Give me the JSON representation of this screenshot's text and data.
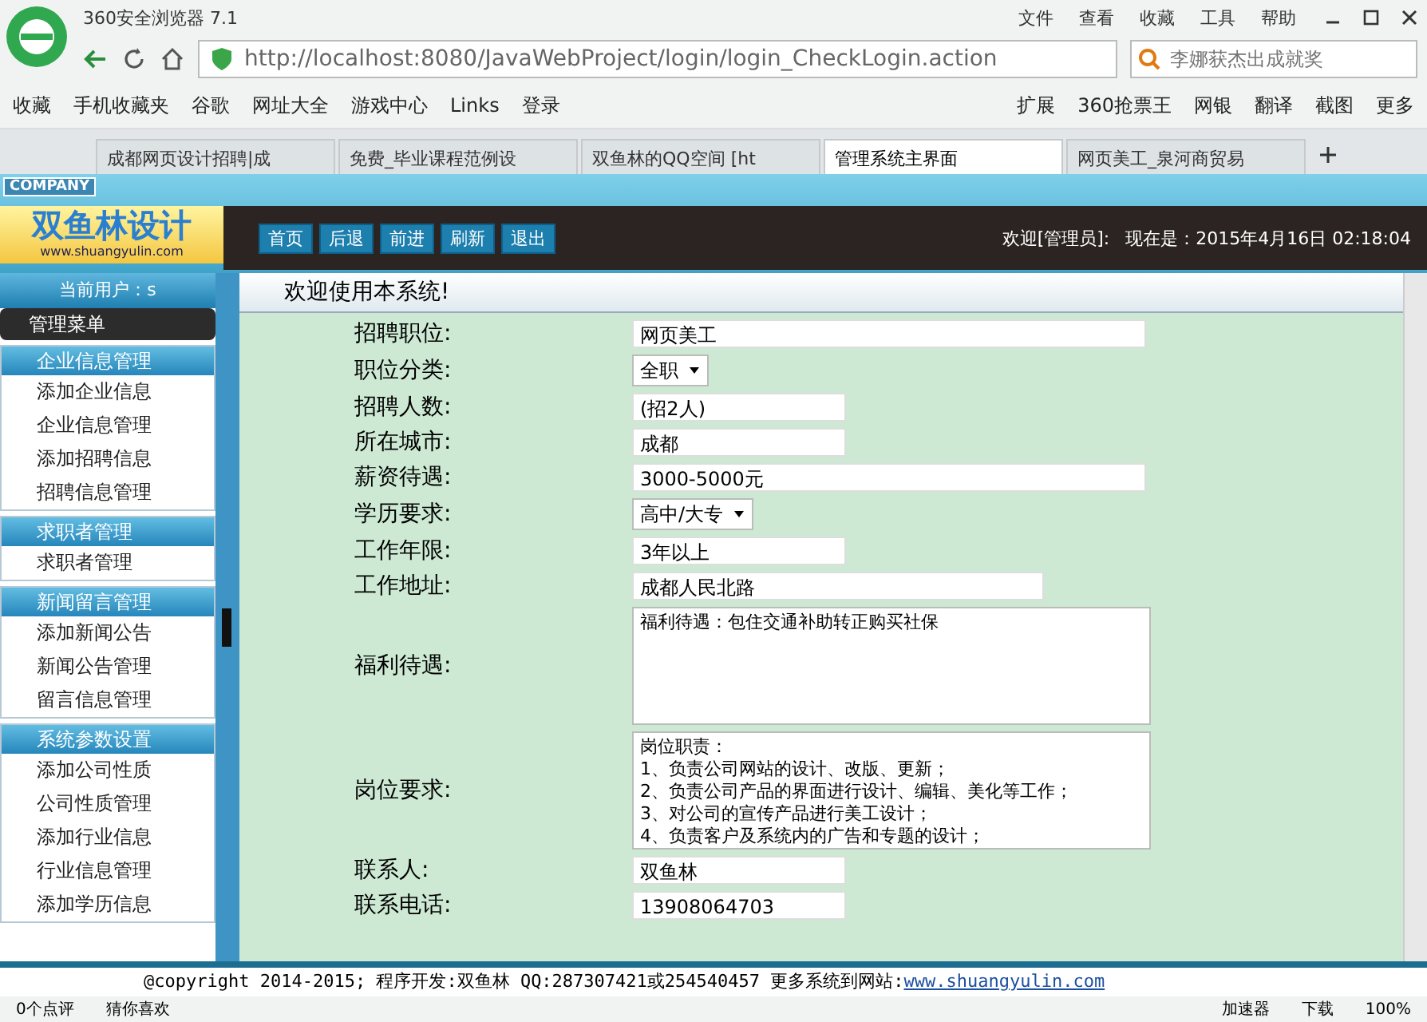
{
  "browser": {
    "title": "360安全浏览器 7.1",
    "menu": [
      "文件",
      "查看",
      "收藏",
      "工具",
      "帮助"
    ],
    "url": "http://localhost:8080/JavaWebProject/login/login_CheckLogin.action",
    "search_placeholder": "李娜获杰出成就奖",
    "bookmarks": [
      "收藏",
      "手机收藏夹",
      "谷歌",
      "网址大全",
      "游戏中心",
      "Links",
      "登录"
    ],
    "extras": [
      "扩展",
      "360抢票王",
      "网银",
      "翻译",
      "截图",
      "更多"
    ],
    "tabs": [
      {
        "label": "成都网页设计招聘|成",
        "selected": false
      },
      {
        "label": "免费_毕业课程范例设",
        "selected": false
      },
      {
        "label": "双鱼林的QQ空间 [ht",
        "selected": false
      },
      {
        "label": "管理系统主界面",
        "selected": true
      },
      {
        "label": "网页美工_泉河商贸易",
        "selected": false
      }
    ]
  },
  "header": {
    "badge": "COMPANY",
    "logo": "双鱼林设计",
    "logo_url": "www.shuangyulin.com",
    "nav": [
      "首页",
      "后退",
      "前进",
      "刷新",
      "退出"
    ],
    "welcome": "欢迎[管理员]:",
    "time": "现在是：2015年4月16日 02:18:04"
  },
  "sidebar": {
    "current_user": "当前用户：s",
    "menu_title": "管理菜单",
    "sections": [
      {
        "title": "企业信息管理",
        "items": [
          "添加企业信息",
          "企业信息管理",
          "添加招聘信息",
          "招聘信息管理"
        ]
      },
      {
        "title": "求职者管理",
        "items": [
          "求职者管理"
        ]
      },
      {
        "title": "新闻留言管理",
        "items": [
          "添加新闻公告",
          "新闻公告管理",
          "留言信息管理"
        ]
      },
      {
        "title": "系统参数设置",
        "items": [
          "添加公司性质",
          "公司性质管理",
          "添加行业信息",
          "行业信息管理",
          "添加学历信息"
        ]
      }
    ]
  },
  "heading": "欢迎使用本系统!",
  "form": [
    {
      "label": "招聘职位:",
      "kind": "long-text",
      "value": "网页美工"
    },
    {
      "label": "职位分类:",
      "kind": "select",
      "value": "全职"
    },
    {
      "label": "招聘人数:",
      "kind": "short-text",
      "value": "(招2人)"
    },
    {
      "label": "所在城市:",
      "kind": "short-text",
      "value": "成都"
    },
    {
      "label": "薪资待遇:",
      "kind": "long-text",
      "value": "3000-5000元"
    },
    {
      "label": "学历要求:",
      "kind": "select",
      "value": "高中/大专"
    },
    {
      "label": "工作年限:",
      "kind": "short-text",
      "value": "3年以上"
    },
    {
      "label": "工作地址:",
      "kind": "medium-text",
      "value": "成都人民北路"
    },
    {
      "label": "福利待遇:",
      "kind": "textarea",
      "lines": [
        "福利待遇：包住交通补助转正购买社保"
      ]
    },
    {
      "label": "岗位要求:",
      "kind": "textarea",
      "lines": [
        "岗位职责：",
        "1、负责公司网站的设计、改版、更新；",
        "2、负责公司产品的界面进行设计、编辑、美化等工作；",
        "3、对公司的宣传产品进行美工设计；",
        "4、负责客户及系统内的广告和专题的设计；"
      ]
    },
    {
      "label": "联系人:",
      "kind": "short-text",
      "value": "双鱼林"
    },
    {
      "label": "联系电话:",
      "kind": "short-text",
      "value": "13908064703"
    }
  ],
  "footer": {
    "text": "@copyright 2014-2015; 程序开发:双鱼林  QQ:287307421或254540457  更多系统到网站:",
    "link": "www.shuangyulin.com"
  },
  "status": [
    "0个点评",
    "猜你喜欢",
    "加速器",
    "下载",
    "100%"
  ]
}
